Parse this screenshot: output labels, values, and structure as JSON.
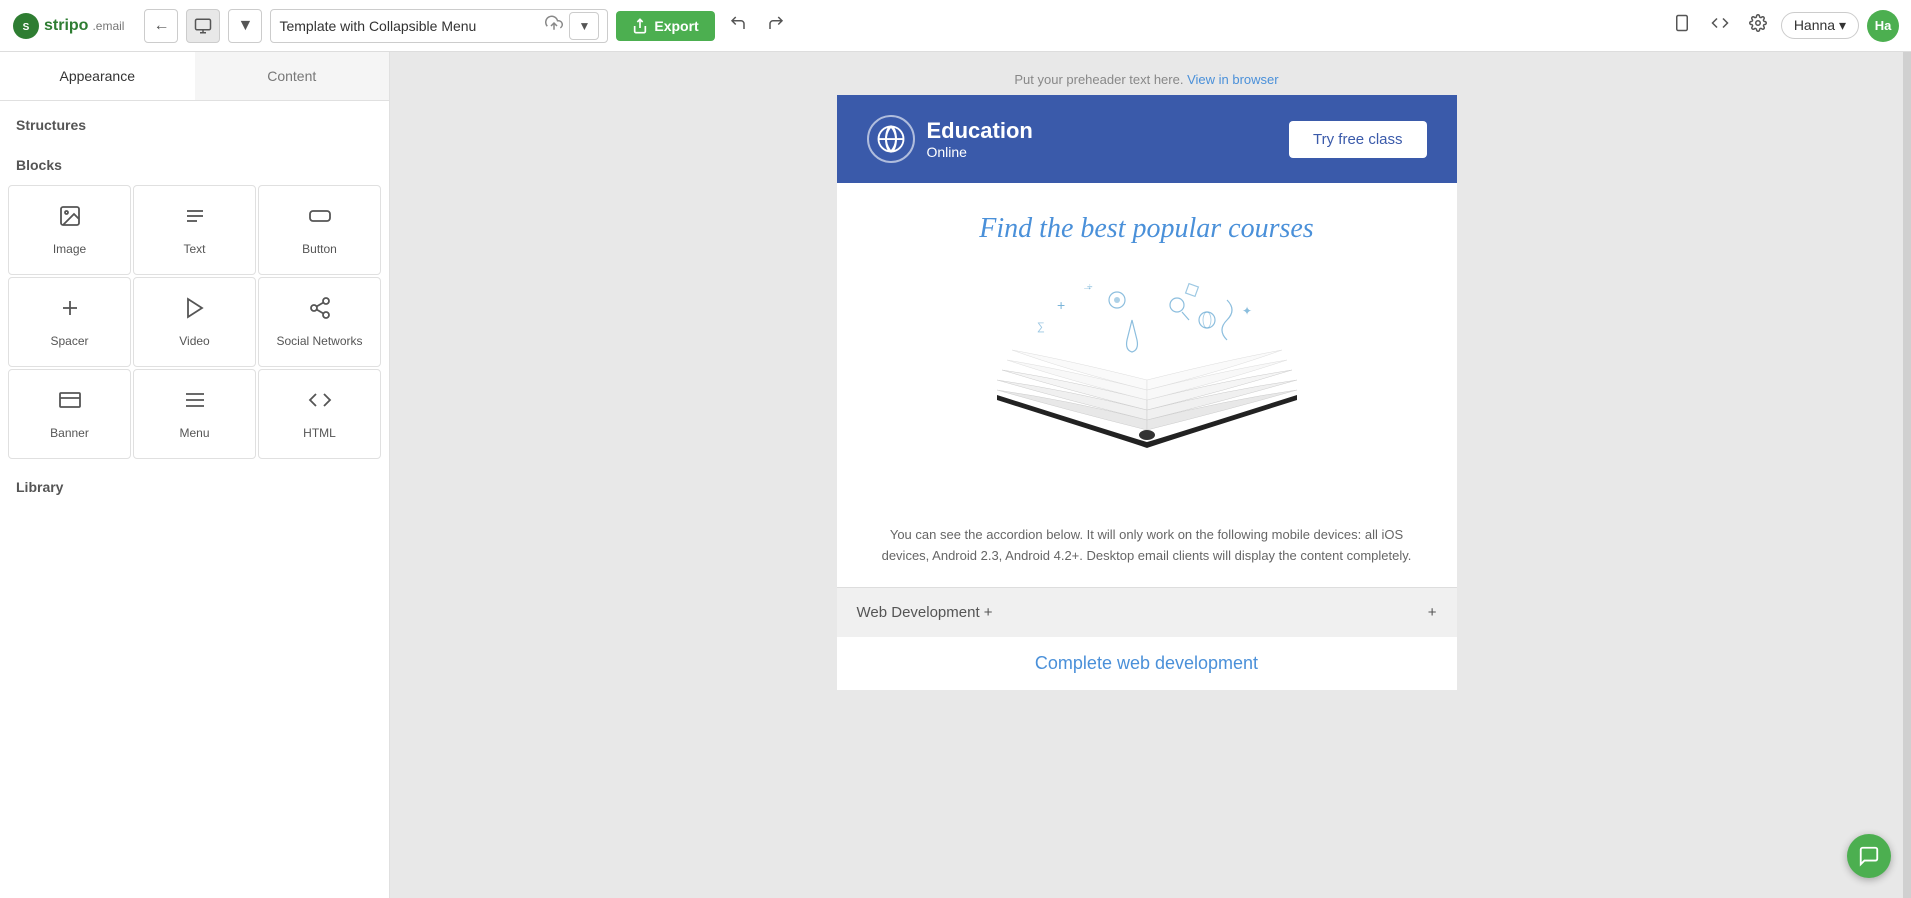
{
  "logo": {
    "text": "stripo",
    "dot": ".",
    "email": "email"
  },
  "topbar": {
    "template_name": "Template with Collapsible Menu",
    "export_label": "Export",
    "user_name": "Hanna",
    "avatar_initials": "Ha",
    "back_title": "Back",
    "forward_title": "Forward",
    "desktop_title": "Desktop view",
    "code_title": "Code editor",
    "settings_title": "Settings",
    "upload_title": "Upload",
    "dropdown_title": "More options",
    "undo_title": "Undo",
    "redo_title": "Redo"
  },
  "left_panel": {
    "tabs": [
      {
        "label": "Appearance",
        "active": true
      },
      {
        "label": "Content",
        "active": false
      }
    ],
    "sections": {
      "structures_title": "Structures",
      "blocks_title": "Blocks",
      "library_title": "Library"
    },
    "blocks": [
      {
        "id": "image",
        "label": "Image",
        "icon": "image"
      },
      {
        "id": "text",
        "label": "Text",
        "icon": "text"
      },
      {
        "id": "button",
        "label": "Button",
        "icon": "button"
      },
      {
        "id": "spacer",
        "label": "Spacer",
        "icon": "spacer"
      },
      {
        "id": "video",
        "label": "Video",
        "icon": "video"
      },
      {
        "id": "social-networks",
        "label": "Social Networks",
        "icon": "share"
      },
      {
        "id": "banner",
        "label": "Banner",
        "icon": "banner"
      },
      {
        "id": "menu",
        "label": "Menu",
        "icon": "menu"
      },
      {
        "id": "html",
        "label": "HTML",
        "icon": "code"
      }
    ]
  },
  "canvas": {
    "preheader_text": "Put your preheader text here.",
    "view_in_browser": "View in browser",
    "header": {
      "logo_icon": "🌐",
      "title_main": "Education",
      "title_sub": "Online",
      "cta_label": "Try free class"
    },
    "hero": {
      "tagline": "Find the best popular courses"
    },
    "description": "You can see the accordion below. It will only work on the following mobile devices: all iOS devices, Android 2.3, Android 4.2+. Desktop email clients will display the content completely.",
    "accordion": [
      {
        "label": "Web Development +"
      }
    ],
    "complete_title": "Complete web development"
  },
  "colors": {
    "header_bg": "#3a5aaa",
    "cta_bg": "#ffffff",
    "cta_text": "#3a5aaa",
    "link_color": "#4a90d9",
    "tagline_color": "#4a90d9",
    "accordion_bg": "#f0f0f0",
    "export_bg": "#4caf50",
    "chat_bg": "#4caf50"
  }
}
